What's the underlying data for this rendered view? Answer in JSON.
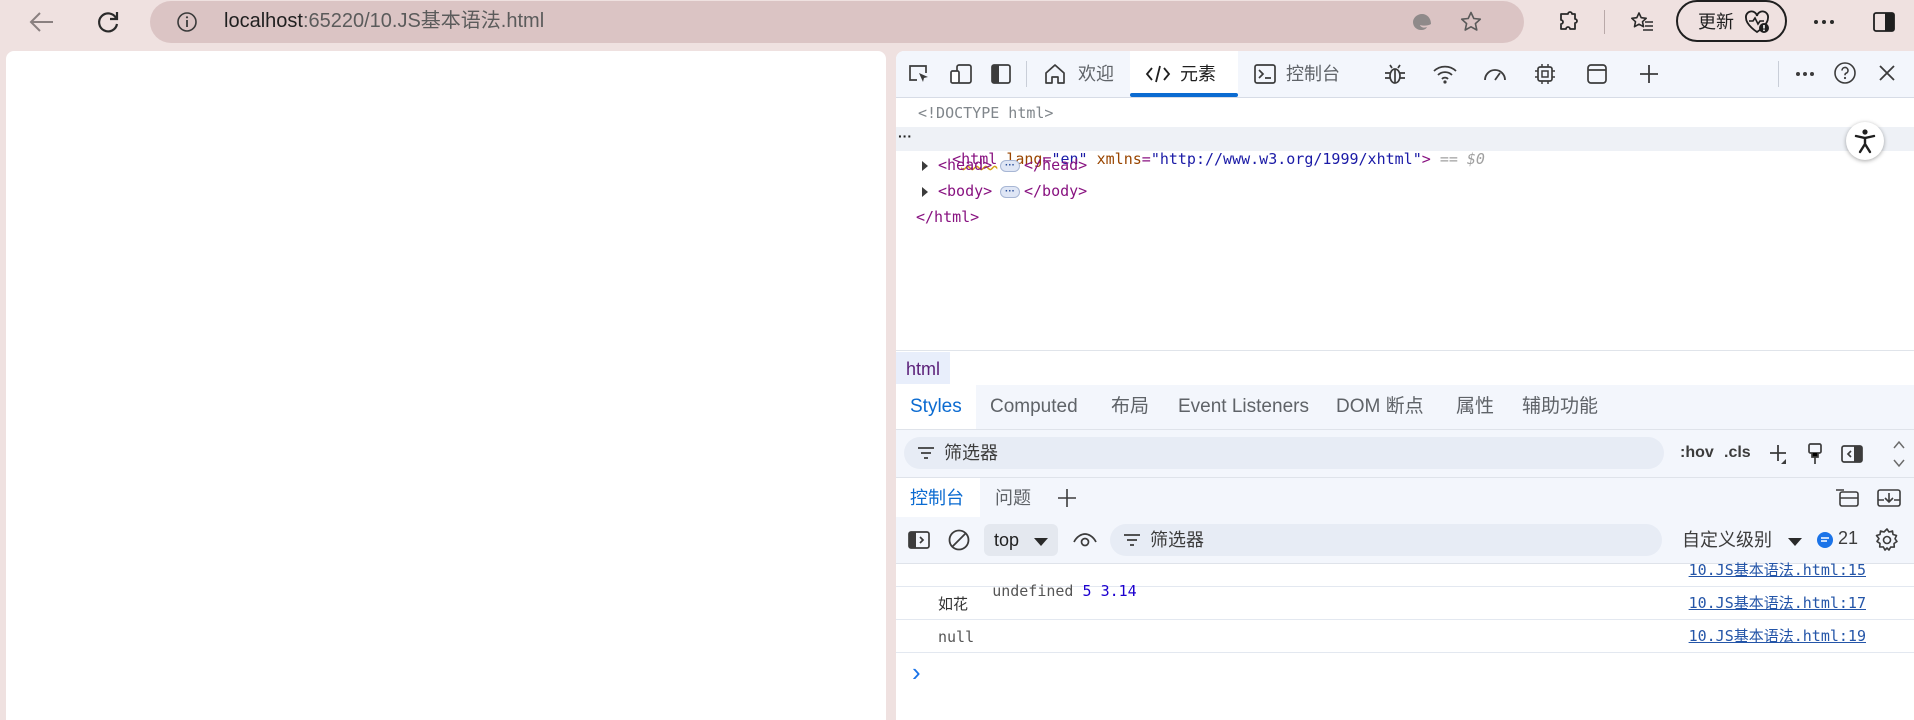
{
  "browser": {
    "url_host": "localhost",
    "url_path": ":65220/10.JS基本语法.html",
    "update_label": "更新"
  },
  "devtools": {
    "tabs": [
      {
        "label": "欢迎"
      },
      {
        "label": "元素"
      },
      {
        "label": "控制台"
      }
    ],
    "active_tab": "元素",
    "dom": {
      "doctype": "<!DOCTYPE html>",
      "html_open": {
        "tag": "html",
        "attr1_name": "lang",
        "attr1_value": "\"en\"",
        "attr2_name": "xmlns",
        "attr2_value": "\"http://www.w3.org/1999/xhtml\"",
        "selected_ref": "== $0"
      },
      "head_open": "<head>",
      "head_close": "</head>",
      "body_open": "<body>",
      "body_close": "</body>",
      "html_close": "</html>"
    },
    "breadcrumb": "html",
    "styles_tabs": [
      {
        "label": "Styles"
      },
      {
        "label": "Computed"
      },
      {
        "label": "布局"
      },
      {
        "label": "Event Listeners"
      },
      {
        "label": "DOM 断点"
      },
      {
        "label": "属性"
      },
      {
        "label": "辅助功能"
      }
    ],
    "styles_filter_placeholder": "筛选器",
    "hov_label": ":hov",
    "cls_label": ".cls",
    "drawer_tabs": [
      {
        "label": "控制台"
      },
      {
        "label": "问题"
      }
    ],
    "console": {
      "context": "top",
      "filter_placeholder": "筛选器",
      "level_label": "自定义级别",
      "message_count": "21",
      "logs": [
        {
          "parts": [
            "undefined",
            "5",
            "3.14"
          ],
          "source": "10.JS基本语法.html:15"
        },
        {
          "parts": [
            "如花"
          ],
          "source": "10.JS基本语法.html:17"
        },
        {
          "parts": [
            "null"
          ],
          "source": "10.JS基本语法.html:19"
        }
      ],
      "prompt": "›"
    }
  },
  "colors": {
    "chrome_bg": "#efe1e0",
    "urlbar_bg": "#dbc4c4",
    "devtools_accent": "#0b6bd1",
    "tag_color": "#881280",
    "attr_color": "#994500",
    "value_color": "#1a1aa6"
  }
}
